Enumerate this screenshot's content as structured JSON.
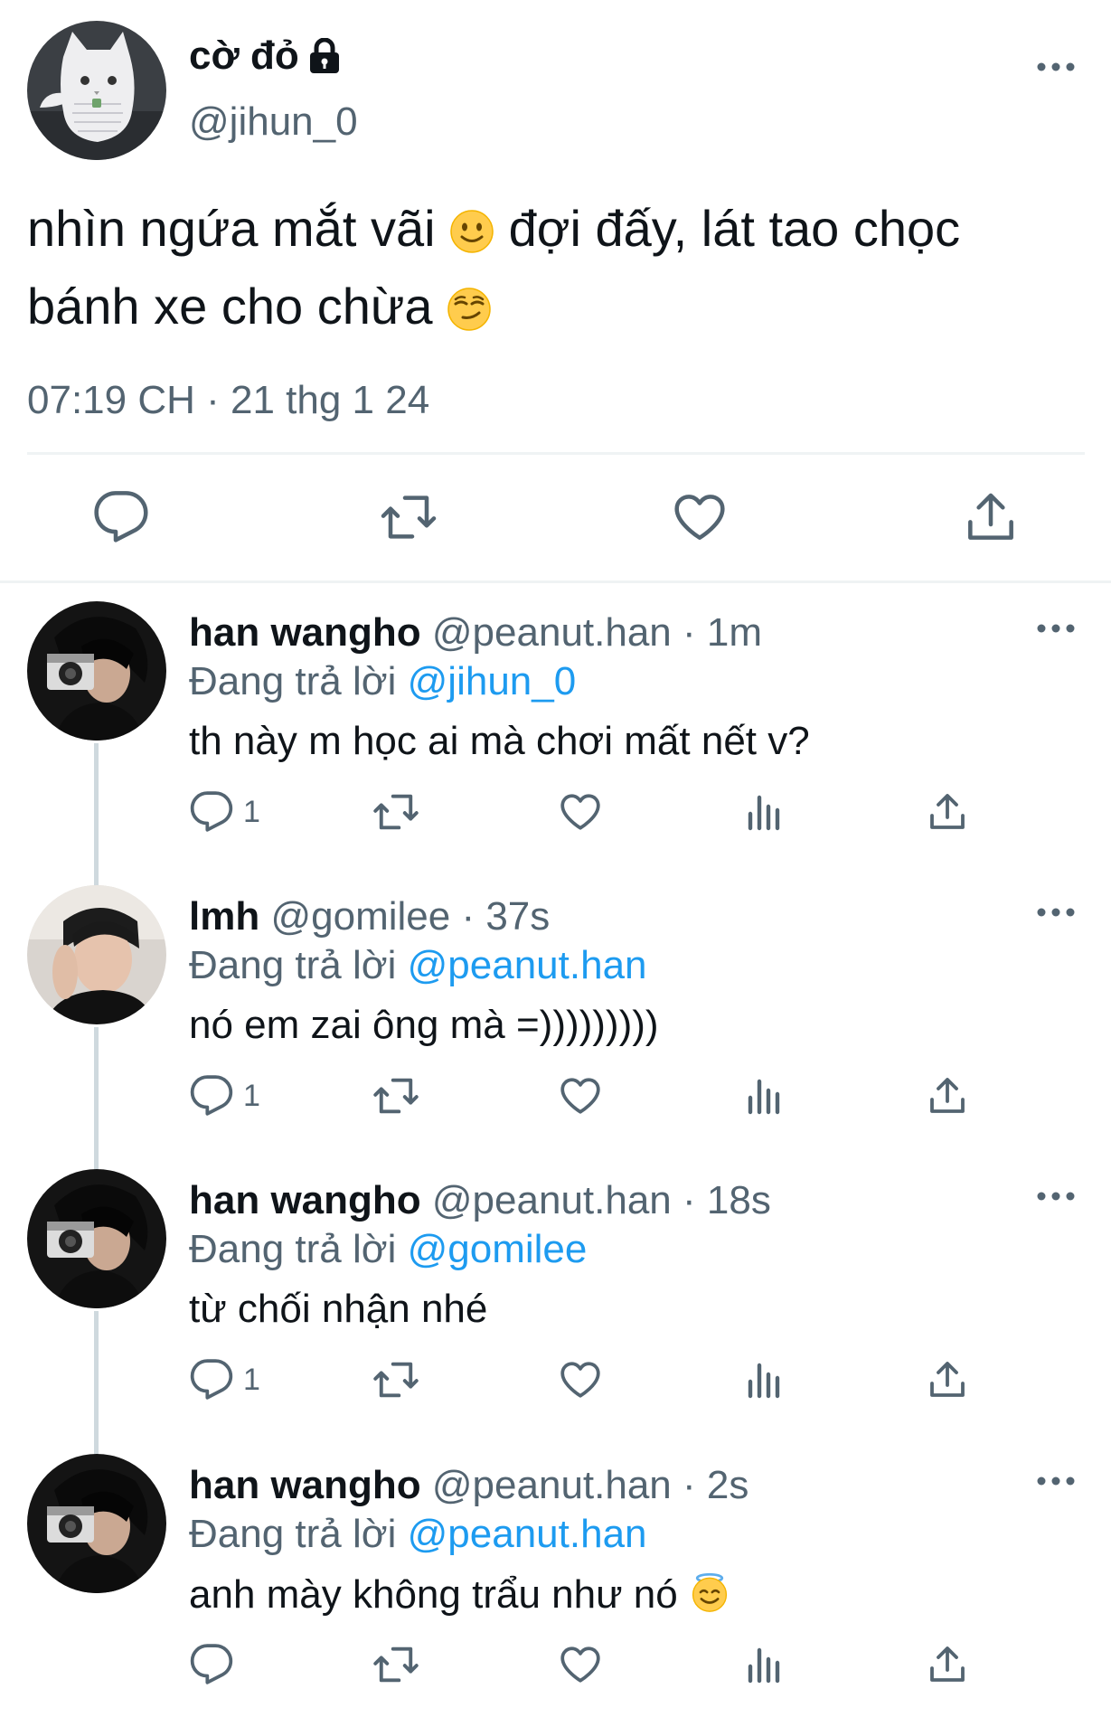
{
  "main_tweet": {
    "display_name": "cờ đỏ",
    "handle": "@jihun_0",
    "text_line1": "nhìn ngứa mắt vãi",
    "text_line1b": " đợi đấy, lát tao chọc",
    "text_line2": "bánh xe cho chừa",
    "timestamp": "07:19 CH · 21 thg 1 24",
    "protected": true,
    "icons": [
      "lock-icon",
      "more-icon",
      "reply-icon",
      "retweet-icon",
      "like-icon",
      "share-icon"
    ]
  },
  "replies": [
    {
      "name": "han wangho",
      "meta": "@peanut.han · 1m",
      "replying_prefix": "Đang trả lời ",
      "replying_to": "@jihun_0",
      "text": "th này m học ai mà chơi mất nết v?",
      "reply_count": "1"
    },
    {
      "name": "lmh",
      "meta": "@gomilee · 37s",
      "replying_prefix": "Đang trả lời ",
      "replying_to": "@peanut.han",
      "text": "nó em zai ông mà =)))))))))",
      "reply_count": "1"
    },
    {
      "name": "han wangho",
      "meta": "@peanut.han · 18s",
      "replying_prefix": "Đang trả lời ",
      "replying_to": "@gomilee",
      "text": "từ chối nhận nhé",
      "reply_count": "1"
    },
    {
      "name": "han wangho",
      "meta": "@peanut.han · 2s",
      "replying_prefix": "Đang trả lời ",
      "replying_to": "@peanut.han",
      "text": "anh mày không trẩu như nó",
      "reply_count": ""
    }
  ],
  "colors": {
    "text": "#0f1419",
    "secondary": "#536471",
    "accent": "#1d9bf0",
    "divider": "#eff3f4"
  }
}
